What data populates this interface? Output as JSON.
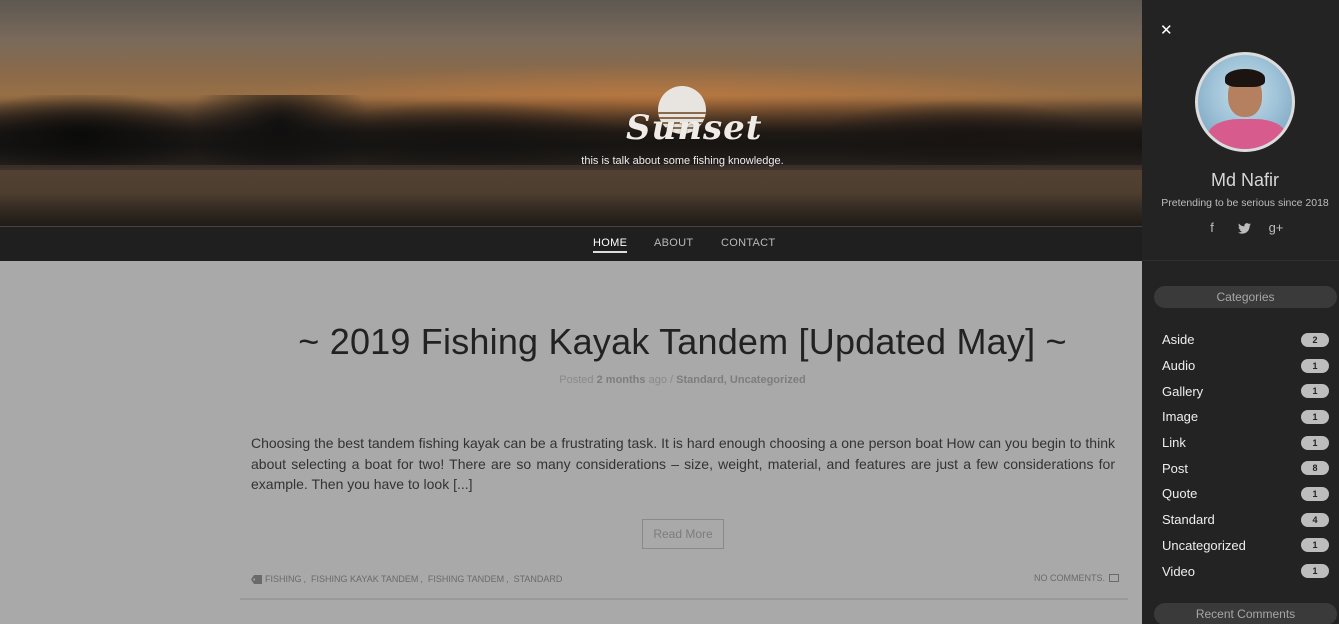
{
  "site": {
    "logo_text": "Sunset",
    "tagline": "this is talk about some fishing knowledge."
  },
  "nav": {
    "items": [
      {
        "label": "HOME",
        "active": true
      },
      {
        "label": "ABOUT",
        "active": false
      },
      {
        "label": "CONTACT",
        "active": false
      }
    ]
  },
  "post": {
    "title": "~ 2019 Fishing Kayak Tandem [Updated May] ~",
    "meta_posted": "Posted",
    "meta_time": "2 months",
    "meta_ago": "ago",
    "meta_sep": "/",
    "meta_categories": "Standard, Uncategorized",
    "excerpt": "Choosing the best tandem fishing kayak can be a frustrating task. It is hard enough choosing a one person boat How can you begin to think about selecting a boat for two! There are so many considerations – size, weight, material, and features are just a few considerations for example. Then you have to look [...]",
    "read_more": "Read More",
    "tags": [
      "FISHING",
      "FISHING KAYAK TANDEM",
      "FISHING TANDEM",
      "STANDARD"
    ],
    "tag_sep": ",",
    "comments": "NO COMMENTS."
  },
  "sidebar": {
    "close_icon": "close-icon",
    "profile": {
      "name": "Md Nafir",
      "bio": "Pretending to be serious since 2018"
    },
    "socials": [
      {
        "icon": "facebook-icon",
        "glyph": "f"
      },
      {
        "icon": "twitter-icon",
        "glyph": "t"
      },
      {
        "icon": "google-plus-icon",
        "glyph": "g+"
      }
    ],
    "categories_title": "Categories",
    "categories": [
      {
        "label": "Aside",
        "count": "2"
      },
      {
        "label": "Audio",
        "count": "1"
      },
      {
        "label": "Gallery",
        "count": "1"
      },
      {
        "label": "Image",
        "count": "1"
      },
      {
        "label": "Link",
        "count": "1"
      },
      {
        "label": "Post",
        "count": "8"
      },
      {
        "label": "Quote",
        "count": "1"
      },
      {
        "label": "Standard",
        "count": "4"
      },
      {
        "label": "Uncategorized",
        "count": "1"
      },
      {
        "label": "Video",
        "count": "1"
      }
    ],
    "recent_comments_title": "Recent Comments"
  }
}
